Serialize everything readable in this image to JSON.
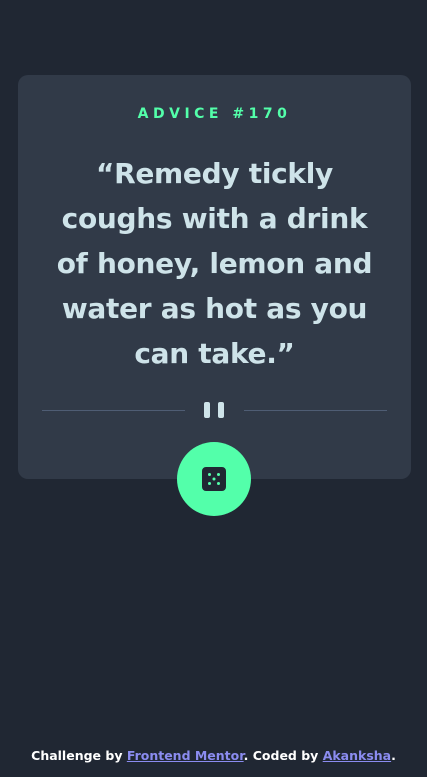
{
  "advice": {
    "label": "ADVICE #170",
    "quote": "“Remedy tickly coughs with a drink of honey, lemon and water as hot as you can take.”"
  },
  "footer": {
    "challenge_prefix": "Challenge by ",
    "challenge_link": "Frontend Mentor",
    "coded_prefix": ". Coded by ",
    "author_link": "Akanksha",
    "suffix": "."
  },
  "colors": {
    "background": "#202733",
    "card": "#313a48",
    "accent": "#53ffaa",
    "text": "#cee3e9",
    "divider": "#4f5d74",
    "link": "#8b8cf0"
  },
  "icons": {
    "divider": "pause-icon",
    "button": "dice-icon"
  }
}
